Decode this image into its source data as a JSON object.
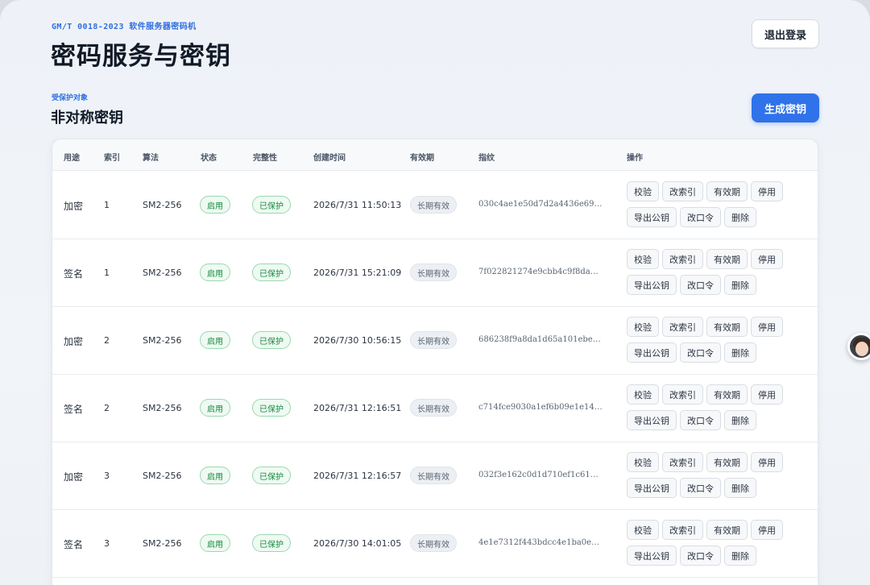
{
  "header": {
    "subtitle": "GM/T 0018-2023 软件服务器密码机",
    "title": "密码服务与密钥",
    "logout_label": "退出登录"
  },
  "section": {
    "kicker": "受保护对象",
    "title": "非对称密钥",
    "generate_label": "生成密钥"
  },
  "table": {
    "columns": [
      "用途",
      "索引",
      "算法",
      "状态",
      "完整性",
      "创建时间",
      "有效期",
      "指纹",
      "操作"
    ],
    "actions": [
      "校验",
      "改索引",
      "有效期",
      "停用",
      "导出公钥",
      "改口令",
      "删除"
    ],
    "rows": [
      {
        "usage": "加密",
        "index": "1",
        "algo": "SM2-256",
        "status": "启用",
        "integrity": "已保护",
        "created": "2026/7/31 11:50:13",
        "validity": "长期有效",
        "fingerprint": "030c4ae1e50d7d2a4436e69f9d…"
      },
      {
        "usage": "签名",
        "index": "1",
        "algo": "SM2-256",
        "status": "启用",
        "integrity": "已保护",
        "created": "2026/7/31 15:21:09",
        "validity": "长期有效",
        "fingerprint": "7f022821274e9cbb4c9f8dad1d…"
      },
      {
        "usage": "加密",
        "index": "2",
        "algo": "SM2-256",
        "status": "启用",
        "integrity": "已保护",
        "created": "2026/7/30 10:56:15",
        "validity": "长期有效",
        "fingerprint": "686238f9a8da1d65a101ebe1b3…"
      },
      {
        "usage": "签名",
        "index": "2",
        "algo": "SM2-256",
        "status": "启用",
        "integrity": "已保护",
        "created": "2026/7/31 12:16:51",
        "validity": "长期有效",
        "fingerprint": "c714fce9030a1ef6b09e1e148c…"
      },
      {
        "usage": "加密",
        "index": "3",
        "algo": "SM2-256",
        "status": "启用",
        "integrity": "已保护",
        "created": "2026/7/31 12:16:57",
        "validity": "长期有效",
        "fingerprint": "032f3e162c0d1d710ef1c618a6…"
      },
      {
        "usage": "签名",
        "index": "3",
        "algo": "SM2-256",
        "status": "启用",
        "integrity": "已保护",
        "created": "2026/7/30 14:01:05",
        "validity": "长期有效",
        "fingerprint": "4e1e7312f443bdcc4e1ba0e4cf…"
      }
    ]
  },
  "colors": {
    "accent": "#2f72ea",
    "success": "#16883f",
    "muted_badge": "#eceff3"
  },
  "icons": {
    "avatar": "user-avatar-icon"
  }
}
